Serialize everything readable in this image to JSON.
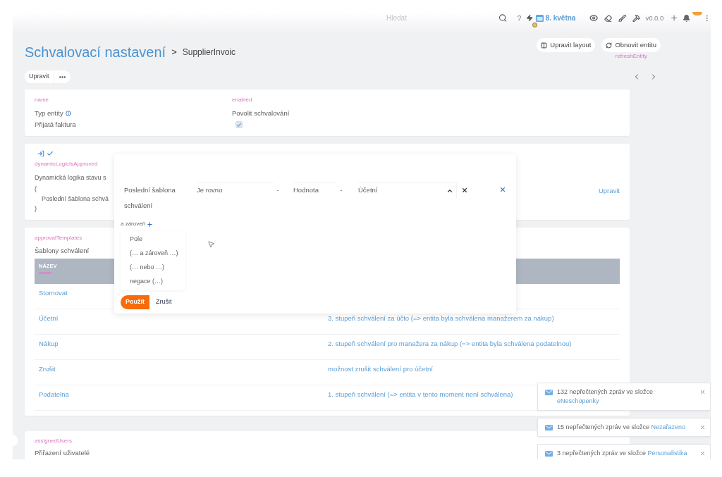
{
  "topbar": {
    "search": {
      "placeholder": "Hledat"
    },
    "help": "?",
    "date": "8. května",
    "version": "v0.0.0"
  },
  "header": {
    "title": "Schvalovací nastavení",
    "separator": ">",
    "breadcrumb": "SupplierInvoic",
    "buttons": [
      {
        "kind": "layout",
        "label": "Upravit layout"
      },
      {
        "kind": "refresh",
        "label": "Obnovit entitu",
        "caption": "refreshEntity"
      }
    ]
  },
  "toolbar": {
    "edit": "Upravit"
  },
  "general_card": {
    "fields": [
      {
        "kind": "text",
        "key": "name",
        "label": "Typ entity",
        "value": "Přijatá faktura"
      },
      {
        "kind": "checkbox",
        "key": "enabled",
        "label": "Povolit schvalování",
        "checked": true,
        "disabled": true
      }
    ]
  },
  "logic_card": {
    "key": "dynamicLogicIsApproved",
    "description": "Dynamická logika stavu s",
    "open": "(",
    "condition": "Poslední šablona schvá",
    "close": ")",
    "action": "Upravit"
  },
  "filter_dialog": {
    "condition": {
      "field": "Poslední šablona schválení",
      "operator": "Je rovno",
      "separator_1": "-",
      "value_type": "Hodnota",
      "separator_2": "-",
      "value": "Účetní",
      "expanded": true
    },
    "add_label": "a zároveň",
    "menu": [
      "Pole",
      "(… a zároveň …)",
      "(… nebo …)",
      "negace (…)"
    ],
    "buttons": [
      {
        "kind": "primary",
        "label": "Použít"
      },
      {
        "kind": "secondary",
        "label": "Zrušit"
      }
    ]
  },
  "templates_card": {
    "key": "approvalTemplates",
    "title": "Šablony schválení",
    "columns": [
      "NÁZEV"
    ],
    "rows": [
      {
        "name": "Stornovat"
      },
      {
        "name": "Účetní",
        "description": "3. stupeň schválení za účto (=> entita byla schválena manažerem za nákup)"
      },
      {
        "name": "Nákup",
        "description": "2. stupeň schválení pro manažera za nákup (=> entita byla schválena podatelnou)"
      },
      {
        "name": "Zrušit",
        "description": "možnost zrušit schválení pro účetní"
      },
      {
        "name": "Podatelna",
        "description": "1. stupeň schválení (=> entita v tento moment není schválena)"
      }
    ]
  },
  "users_card": {
    "key": "assignedUsers",
    "title": "Přiřazení uživatelé"
  },
  "notifications": [
    {
      "text": "132 nepřečtených zpráv ve složce",
      "folder": "eNeschopenky"
    },
    {
      "text": "15 nepřečtených zpráv ve složce",
      "folder": "Nezařazeno"
    },
    {
      "text": "3 nepřečtených zpráv ve složce",
      "folder": "Personalistika"
    }
  ]
}
